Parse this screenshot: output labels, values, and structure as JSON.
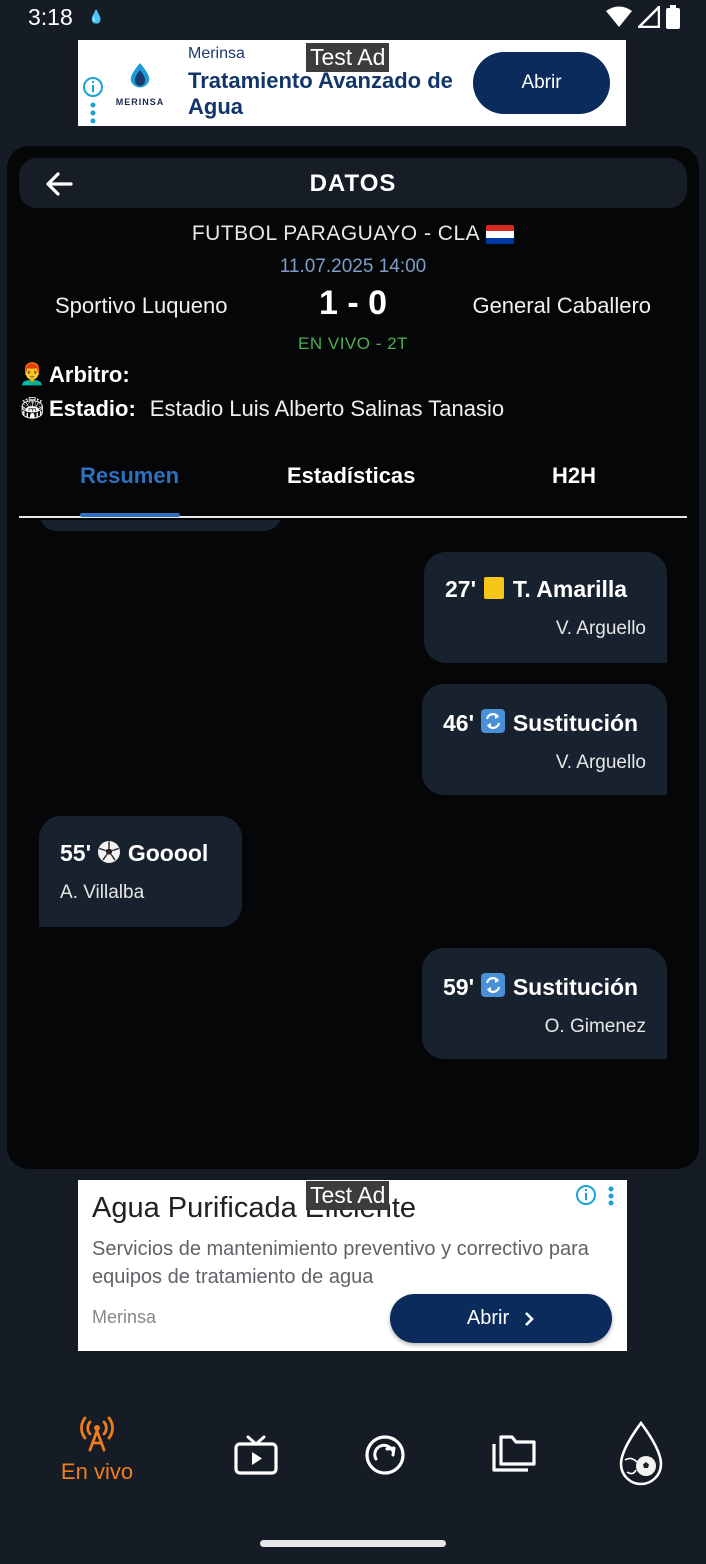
{
  "status_bar": {
    "time": "3:18"
  },
  "top_ad": {
    "tag": "Test Ad",
    "brand": "Merinsa",
    "logo_text": "MERINSA",
    "headline": "Tratamiento Avanzado de Agua",
    "button": "Abrir"
  },
  "header": {
    "title": "DATOS"
  },
  "match": {
    "league": "FUTBOL PARAGUAYO - CLA",
    "datetime": "11.07.2025 14:00",
    "home_team": "Sportivo Luqueno",
    "score": "1 - 0",
    "away_team": "General Caballero",
    "status": "EN VIVO - 2T"
  },
  "info": {
    "referee_label": "Arbitro:",
    "referee_value": "",
    "stadium_label": "Estadio:",
    "stadium_value": "Estadio Luis Alberto Salinas Tanasio"
  },
  "tabs": [
    {
      "label": "Resumen",
      "active": true
    },
    {
      "label": "Estadísticas",
      "active": false
    },
    {
      "label": "H2H",
      "active": false
    }
  ],
  "events": [
    {
      "minute": "27'",
      "icon": "yellow-card-icon",
      "type": "T. Amarilla",
      "player": "V. Arguello",
      "side": "right"
    },
    {
      "minute": "46'",
      "icon": "substitution-icon",
      "type": "Sustitución",
      "player": "V. Arguello",
      "side": "right"
    },
    {
      "minute": "55'",
      "icon": "soccer-ball-icon",
      "type": "Gooool",
      "player": "A. Villalba",
      "side": "left"
    },
    {
      "minute": "59'",
      "icon": "substitution-icon",
      "type": "Sustitución",
      "player": "O. Gimenez",
      "side": "right"
    }
  ],
  "bottom_ad": {
    "tag": "Test Ad",
    "headline": "Agua Purificada Eficiente",
    "description": "Servicios de mantenimiento preventivo y correctivo para equipos de tratamiento de agua",
    "brand": "Merinsa",
    "button": "Abrir"
  },
  "bottom_nav": {
    "items": [
      {
        "label": "En vivo",
        "icon": "broadcast-icon",
        "active": true
      },
      {
        "label": "",
        "icon": "tv-play-icon",
        "active": false
      },
      {
        "label": "",
        "icon": "refresh-circle-icon",
        "active": false
      },
      {
        "label": "",
        "icon": "folders-icon",
        "active": false
      },
      {
        "label": "",
        "icon": "app-logo-drop-ball-icon",
        "active": false
      }
    ]
  },
  "colors": {
    "background": "#151c26",
    "card": "#050608",
    "event_bubble": "#18222e",
    "accent_blue": "#2f6fbf",
    "live_green": "#4caf50",
    "nav_active": "#f07d1c",
    "ad_button": "#0b2b5c"
  }
}
